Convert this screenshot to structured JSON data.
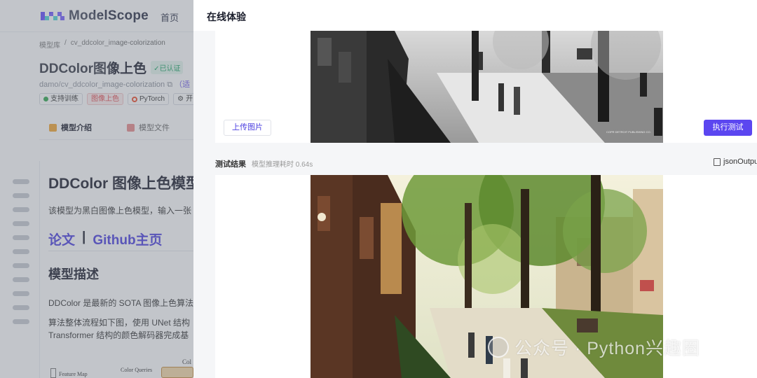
{
  "brand": {
    "name": "ModelScope"
  },
  "nav": {
    "home": "首页"
  },
  "breadcrumb": {
    "root": "模型库",
    "sep": "/",
    "current": "cv_ddcolor_image-colorization"
  },
  "model": {
    "title": "DDColor图像上色",
    "verified": "已认证",
    "path": "damo/cv_ddcolor_image-colorization",
    "path_extra": "（适"
  },
  "tags": [
    "支持训练",
    "图像上色",
    "PyTorch",
    "开"
  ],
  "tabs": [
    "模型介绍",
    "模型文件"
  ],
  "article": {
    "heading": "DDColor 图像上色模型",
    "intro": "该模型为黑白图像上色模型，输入一张",
    "link_paper": "论文",
    "link_sep": "|",
    "link_github": "Github主页",
    "section_title": "模型描述",
    "para1": "DDColor 是最新的 SOTA 图像上色算法",
    "para2": "算法整体流程如下图，使用 UNet 结构",
    "para3": "Transformer 结构的颜色解码器完成基"
  },
  "diagram_fragment": {
    "feature_map": "Feature Map",
    "color_queries": "Color Queries",
    "cut": "Col"
  },
  "drawer": {
    "title": "在线体验",
    "upload_label": "上传图片",
    "run_label": "执行测试",
    "result_title": "测试结果",
    "result_time": "模型推理耗时 0.64s",
    "json_label": "jsonOutpu",
    "photo_caption": "COPR DETROIT PUBLISHING CO."
  },
  "watermark": {
    "text": "公众号 · Python兴趣圈"
  },
  "colors": {
    "accent": "#5b46f0",
    "link": "#4b3fe0",
    "verified": "#19a463"
  }
}
